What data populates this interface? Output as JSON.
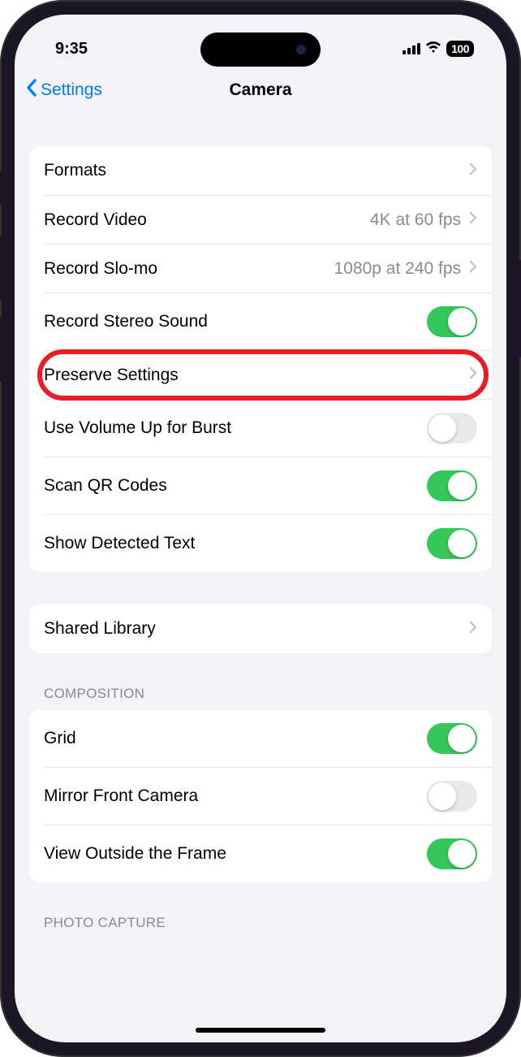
{
  "status": {
    "time": "9:35",
    "battery": "100"
  },
  "nav": {
    "back": "Settings",
    "title": "Camera"
  },
  "groups": {
    "main": {
      "formats": {
        "label": "Formats"
      },
      "recordVideo": {
        "label": "Record Video",
        "value": "4K at 60 fps"
      },
      "recordSlomo": {
        "label": "Record Slo-mo",
        "value": "1080p at 240 fps"
      },
      "stereo": {
        "label": "Record Stereo Sound",
        "on": true
      },
      "preserve": {
        "label": "Preserve Settings"
      },
      "volumeBurst": {
        "label": "Use Volume Up for Burst",
        "on": false
      },
      "scanQR": {
        "label": "Scan QR Codes",
        "on": true
      },
      "detectedText": {
        "label": "Show Detected Text",
        "on": true
      }
    },
    "library": {
      "shared": {
        "label": "Shared Library"
      }
    },
    "composition": {
      "header": "COMPOSITION",
      "grid": {
        "label": "Grid",
        "on": true
      },
      "mirror": {
        "label": "Mirror Front Camera",
        "on": false
      },
      "outsideFrame": {
        "label": "View Outside the Frame",
        "on": true
      }
    },
    "photoCapture": {
      "header": "PHOTO CAPTURE"
    }
  }
}
